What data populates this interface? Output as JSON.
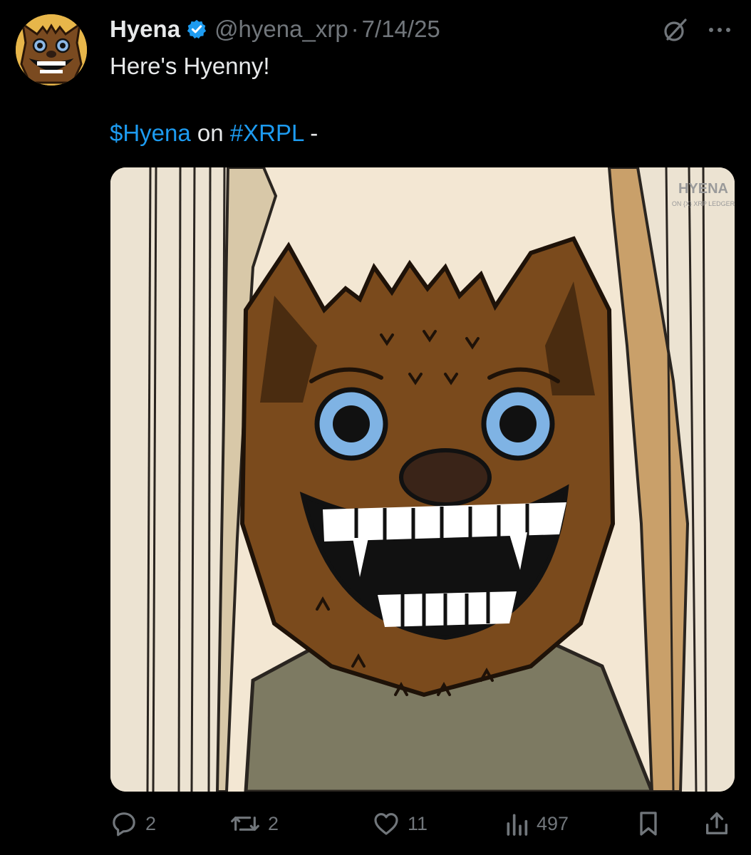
{
  "tweet": {
    "display_name": "Hyena",
    "handle": "@hyena_xrp",
    "separator": "·",
    "date": "7/14/25",
    "text_line1": "Here's Hyenny!",
    "cashtag": "$Hyena",
    "text_on": " on ",
    "hashtag": "#XRPL",
    "text_dash": " -",
    "media_watermark": "HYENA ON XRP LEDGER"
  },
  "actions": {
    "replies": "2",
    "reposts": "2",
    "likes": "11",
    "views": "497"
  },
  "icons": {
    "verified": "verified-badge-icon",
    "grok": "grok-icon",
    "more": "more-icon",
    "reply": "reply-icon",
    "repost": "repost-icon",
    "like": "heart-icon",
    "views": "views-icon",
    "bookmark": "bookmark-icon",
    "share": "share-icon"
  },
  "colors": {
    "background": "#000000",
    "text": "#e7e9ea",
    "muted": "#71767b",
    "link": "#1d9bf0",
    "verified": "#1d9bf0"
  }
}
